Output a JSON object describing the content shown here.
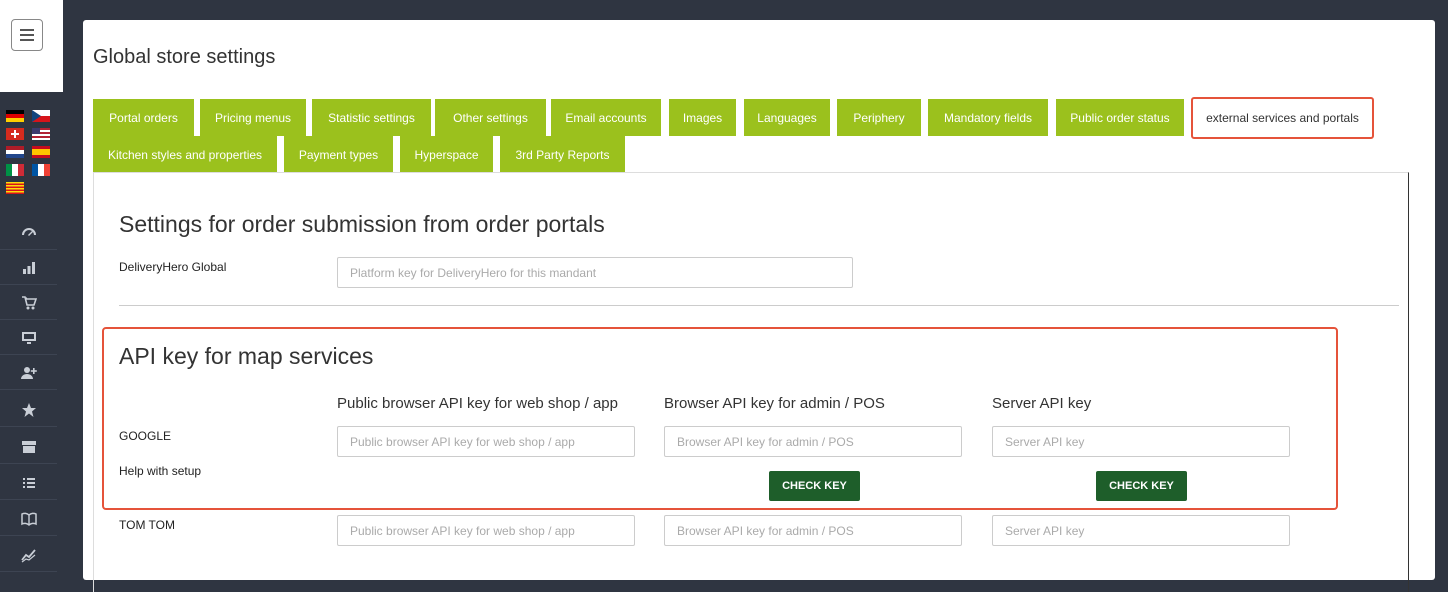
{
  "page": {
    "title": "Global store settings"
  },
  "tabs": {
    "row1": [
      "Portal orders",
      "Pricing menus",
      "Statistic settings",
      "Other settings",
      "Email accounts",
      "Images",
      "Languages",
      "Periphery",
      "Mandatory fields",
      "Public order status"
    ],
    "active": "external services and portals",
    "row2": [
      "Kitchen styles and properties",
      "Payment types",
      "Hyperspace",
      "3rd Party Reports"
    ]
  },
  "portals": {
    "title": "Settings for order submission from order portals",
    "deliveryhero_label": "DeliveryHero Global",
    "deliveryhero_placeholder": "Platform key for DeliveryHero for this mandant"
  },
  "map_api": {
    "title": "API key for map services",
    "col_public": "Public browser API key for web shop / app",
    "col_admin": "Browser API key for admin / POS",
    "col_server": "Server API key",
    "google_label": "GOOGLE",
    "help_label": "Help with setup",
    "tomtom_label": "TOM TOM",
    "placeholder_public": "Public browser API key for web shop / app",
    "placeholder_admin": "Browser API key for admin / POS",
    "placeholder_server": "Server API key",
    "check_key": "CHECK KEY"
  },
  "sidebar": {
    "flags": [
      "german-flag",
      "czech-flag",
      "swiss-flag",
      "us-flag",
      "dutch-flag",
      "spanish-flag",
      "italian-flag",
      "french-flag",
      "catalan-flag"
    ],
    "icons": [
      "dashboard-icon",
      "bar-chart-icon",
      "cart-icon",
      "monitor-icon",
      "add-user-icon",
      "star-icon",
      "archive-icon",
      "list-icon",
      "book-icon",
      "trend-icon"
    ]
  },
  "colors": {
    "tab_green": "#9bc11d",
    "button_green": "#1e5e2a",
    "highlight_red": "#e5533a",
    "sidebar": "#2f3541"
  }
}
